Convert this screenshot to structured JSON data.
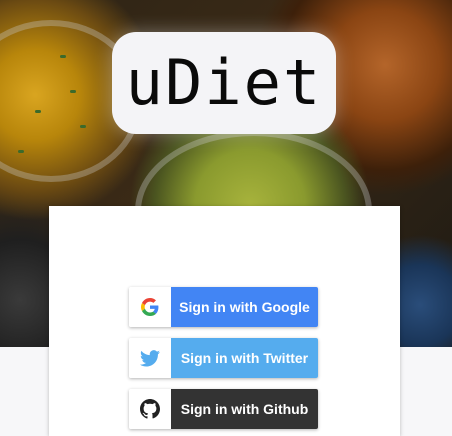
{
  "app": {
    "logo_text": "uDiet"
  },
  "signin": {
    "buttons": [
      {
        "label": "Sign in with Google",
        "icon": "google-icon",
        "color": "#4285f4"
      },
      {
        "label": "Sign in with Twitter",
        "icon": "twitter-icon",
        "color": "#55acee"
      },
      {
        "label": "Sign in with Github",
        "icon": "github-icon",
        "color": "#333333"
      }
    ]
  },
  "colors": {
    "page_background": "#f7f7f9",
    "card_background": "#ffffff",
    "logo_background": "#f4f4f7"
  }
}
